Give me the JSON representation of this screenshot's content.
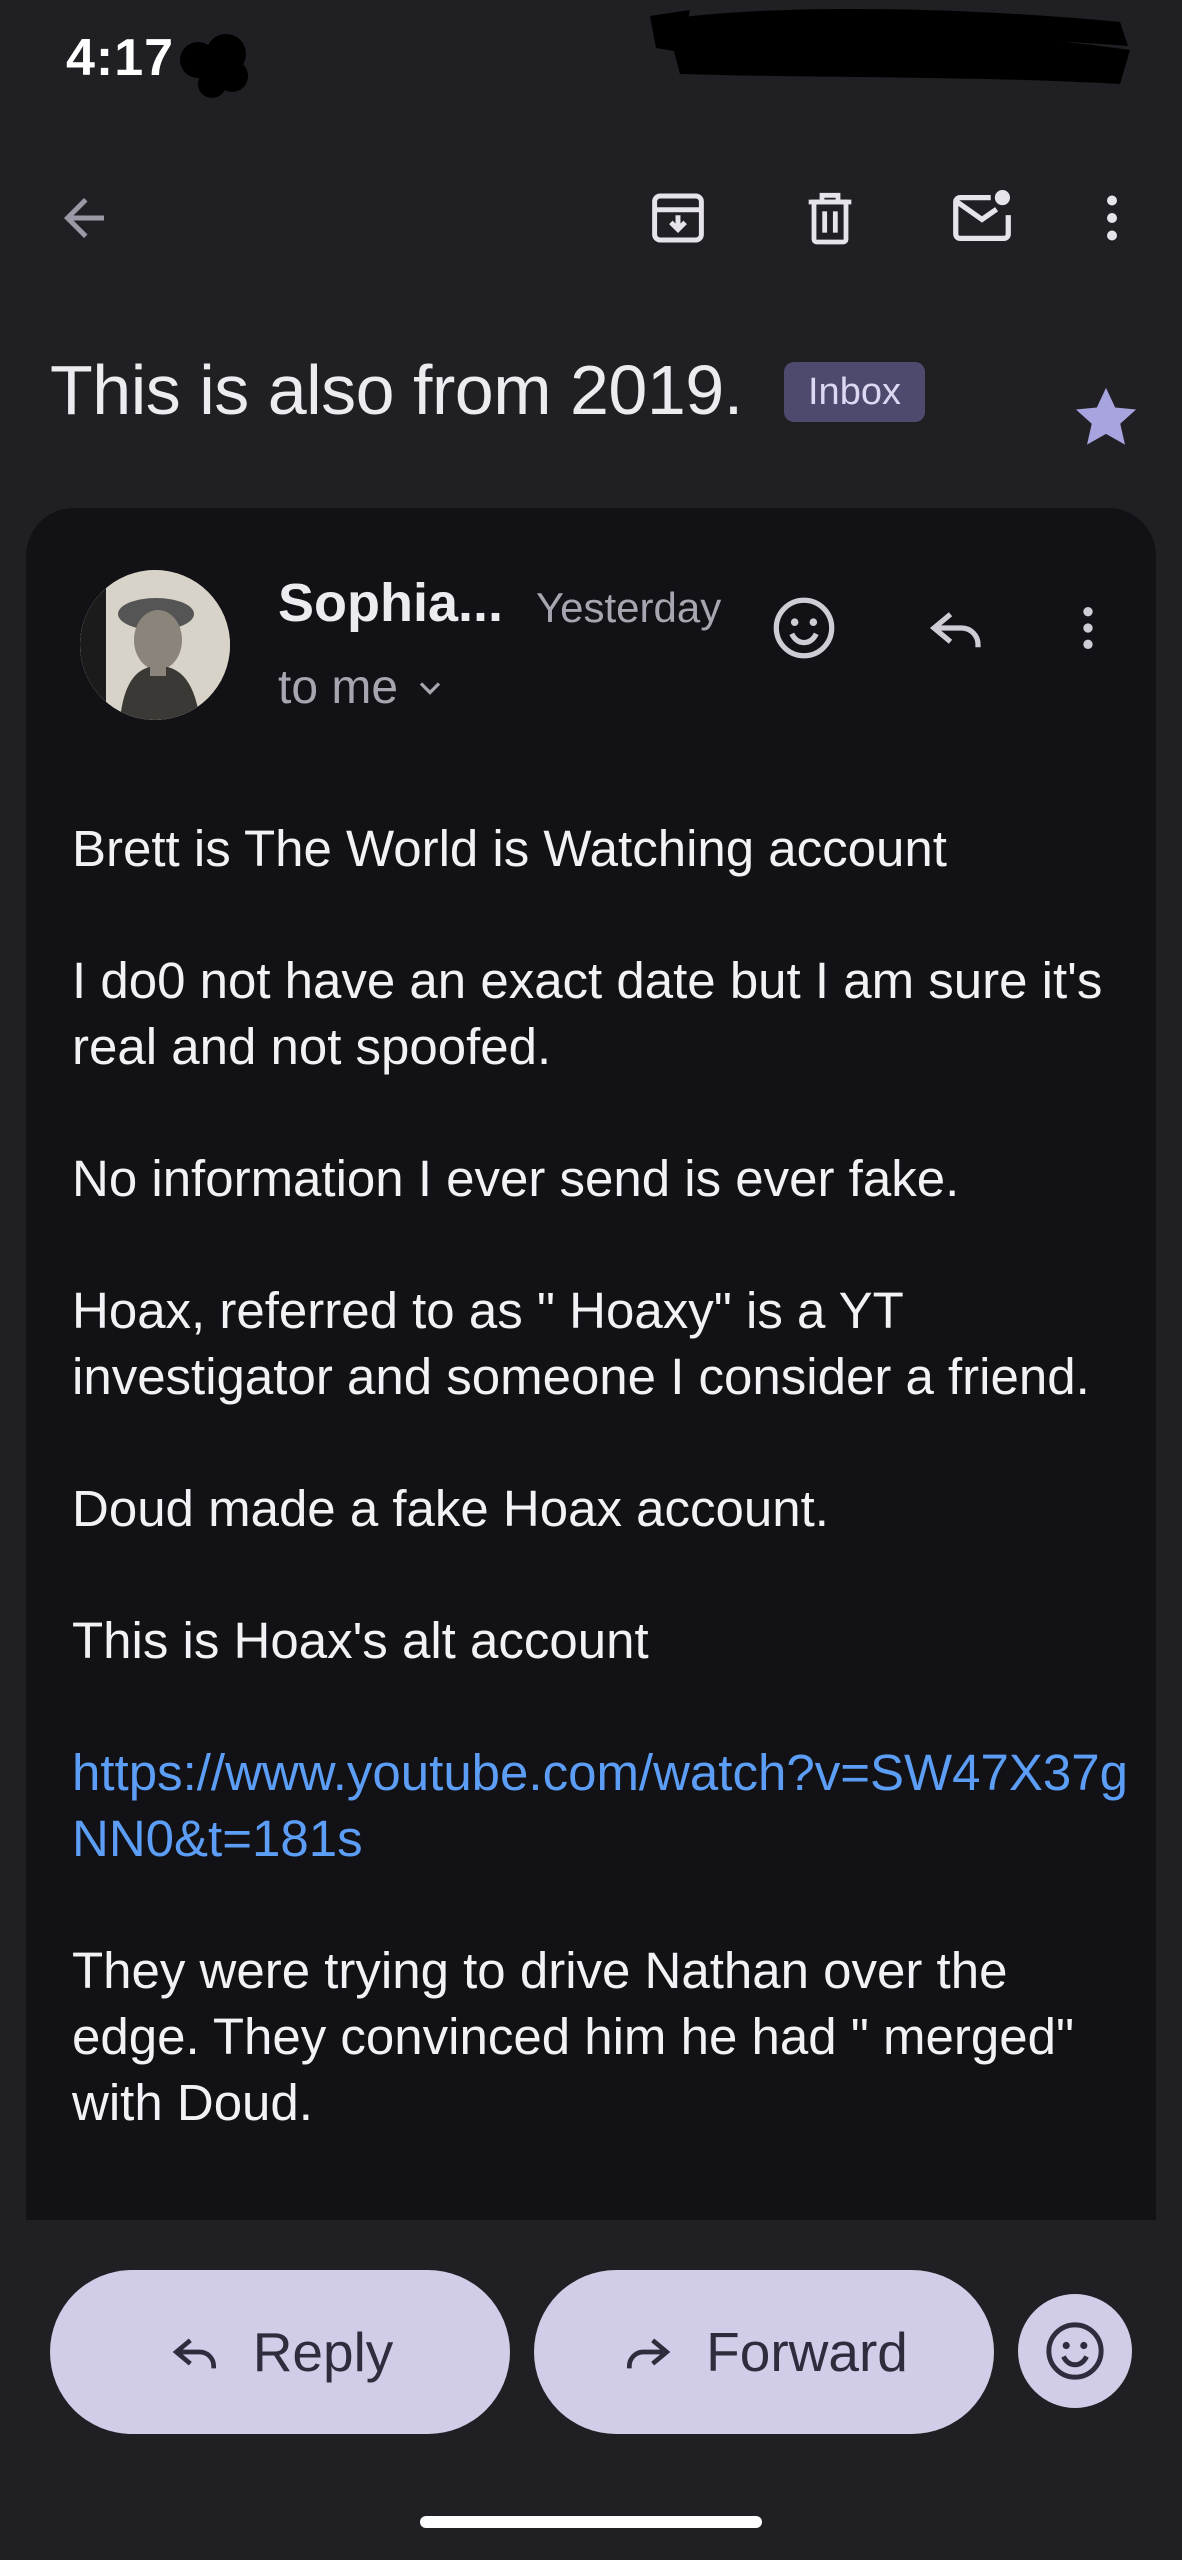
{
  "status_bar": {
    "time": "4:17"
  },
  "toolbar": {
    "back": "back-arrow-icon",
    "archive": "archive-icon",
    "delete": "trash-icon",
    "mark_unread": "mark-unread-icon",
    "more": "more-vert-icon"
  },
  "subject": {
    "title": "This is also from 2019.",
    "label": "Inbox",
    "star_color": "#a8a4e0"
  },
  "message": {
    "sender": "Sophia...",
    "date": "Yesterday",
    "recipient": "to me",
    "paragraphs": [
      "Brett is The World is Watching account",
      "I do0 not have an exact date but I am sure it's real and not spoofed.",
      "No information I ever send is ever fake.",
      "Hoax, referred to as \" Hoaxy\" is a YT investigator and someone I consider a friend.",
      "Doud made a fake Hoax account.",
      "This is Hoax's alt account"
    ],
    "link": "https://www.youtube.com/watch?v=SW47X37gNN0&t=181s",
    "after_link": "They were trying to drive Nathan over the edge. They convinced him he had \" merged\" with Doud."
  },
  "actions": {
    "reply": "Reply",
    "forward": "Forward"
  },
  "colors": {
    "background": "#1f1f24",
    "card": "#121116",
    "accent_pill": "#d1cde8",
    "link": "#5c9ef5",
    "badge": "#4d4a6d"
  }
}
